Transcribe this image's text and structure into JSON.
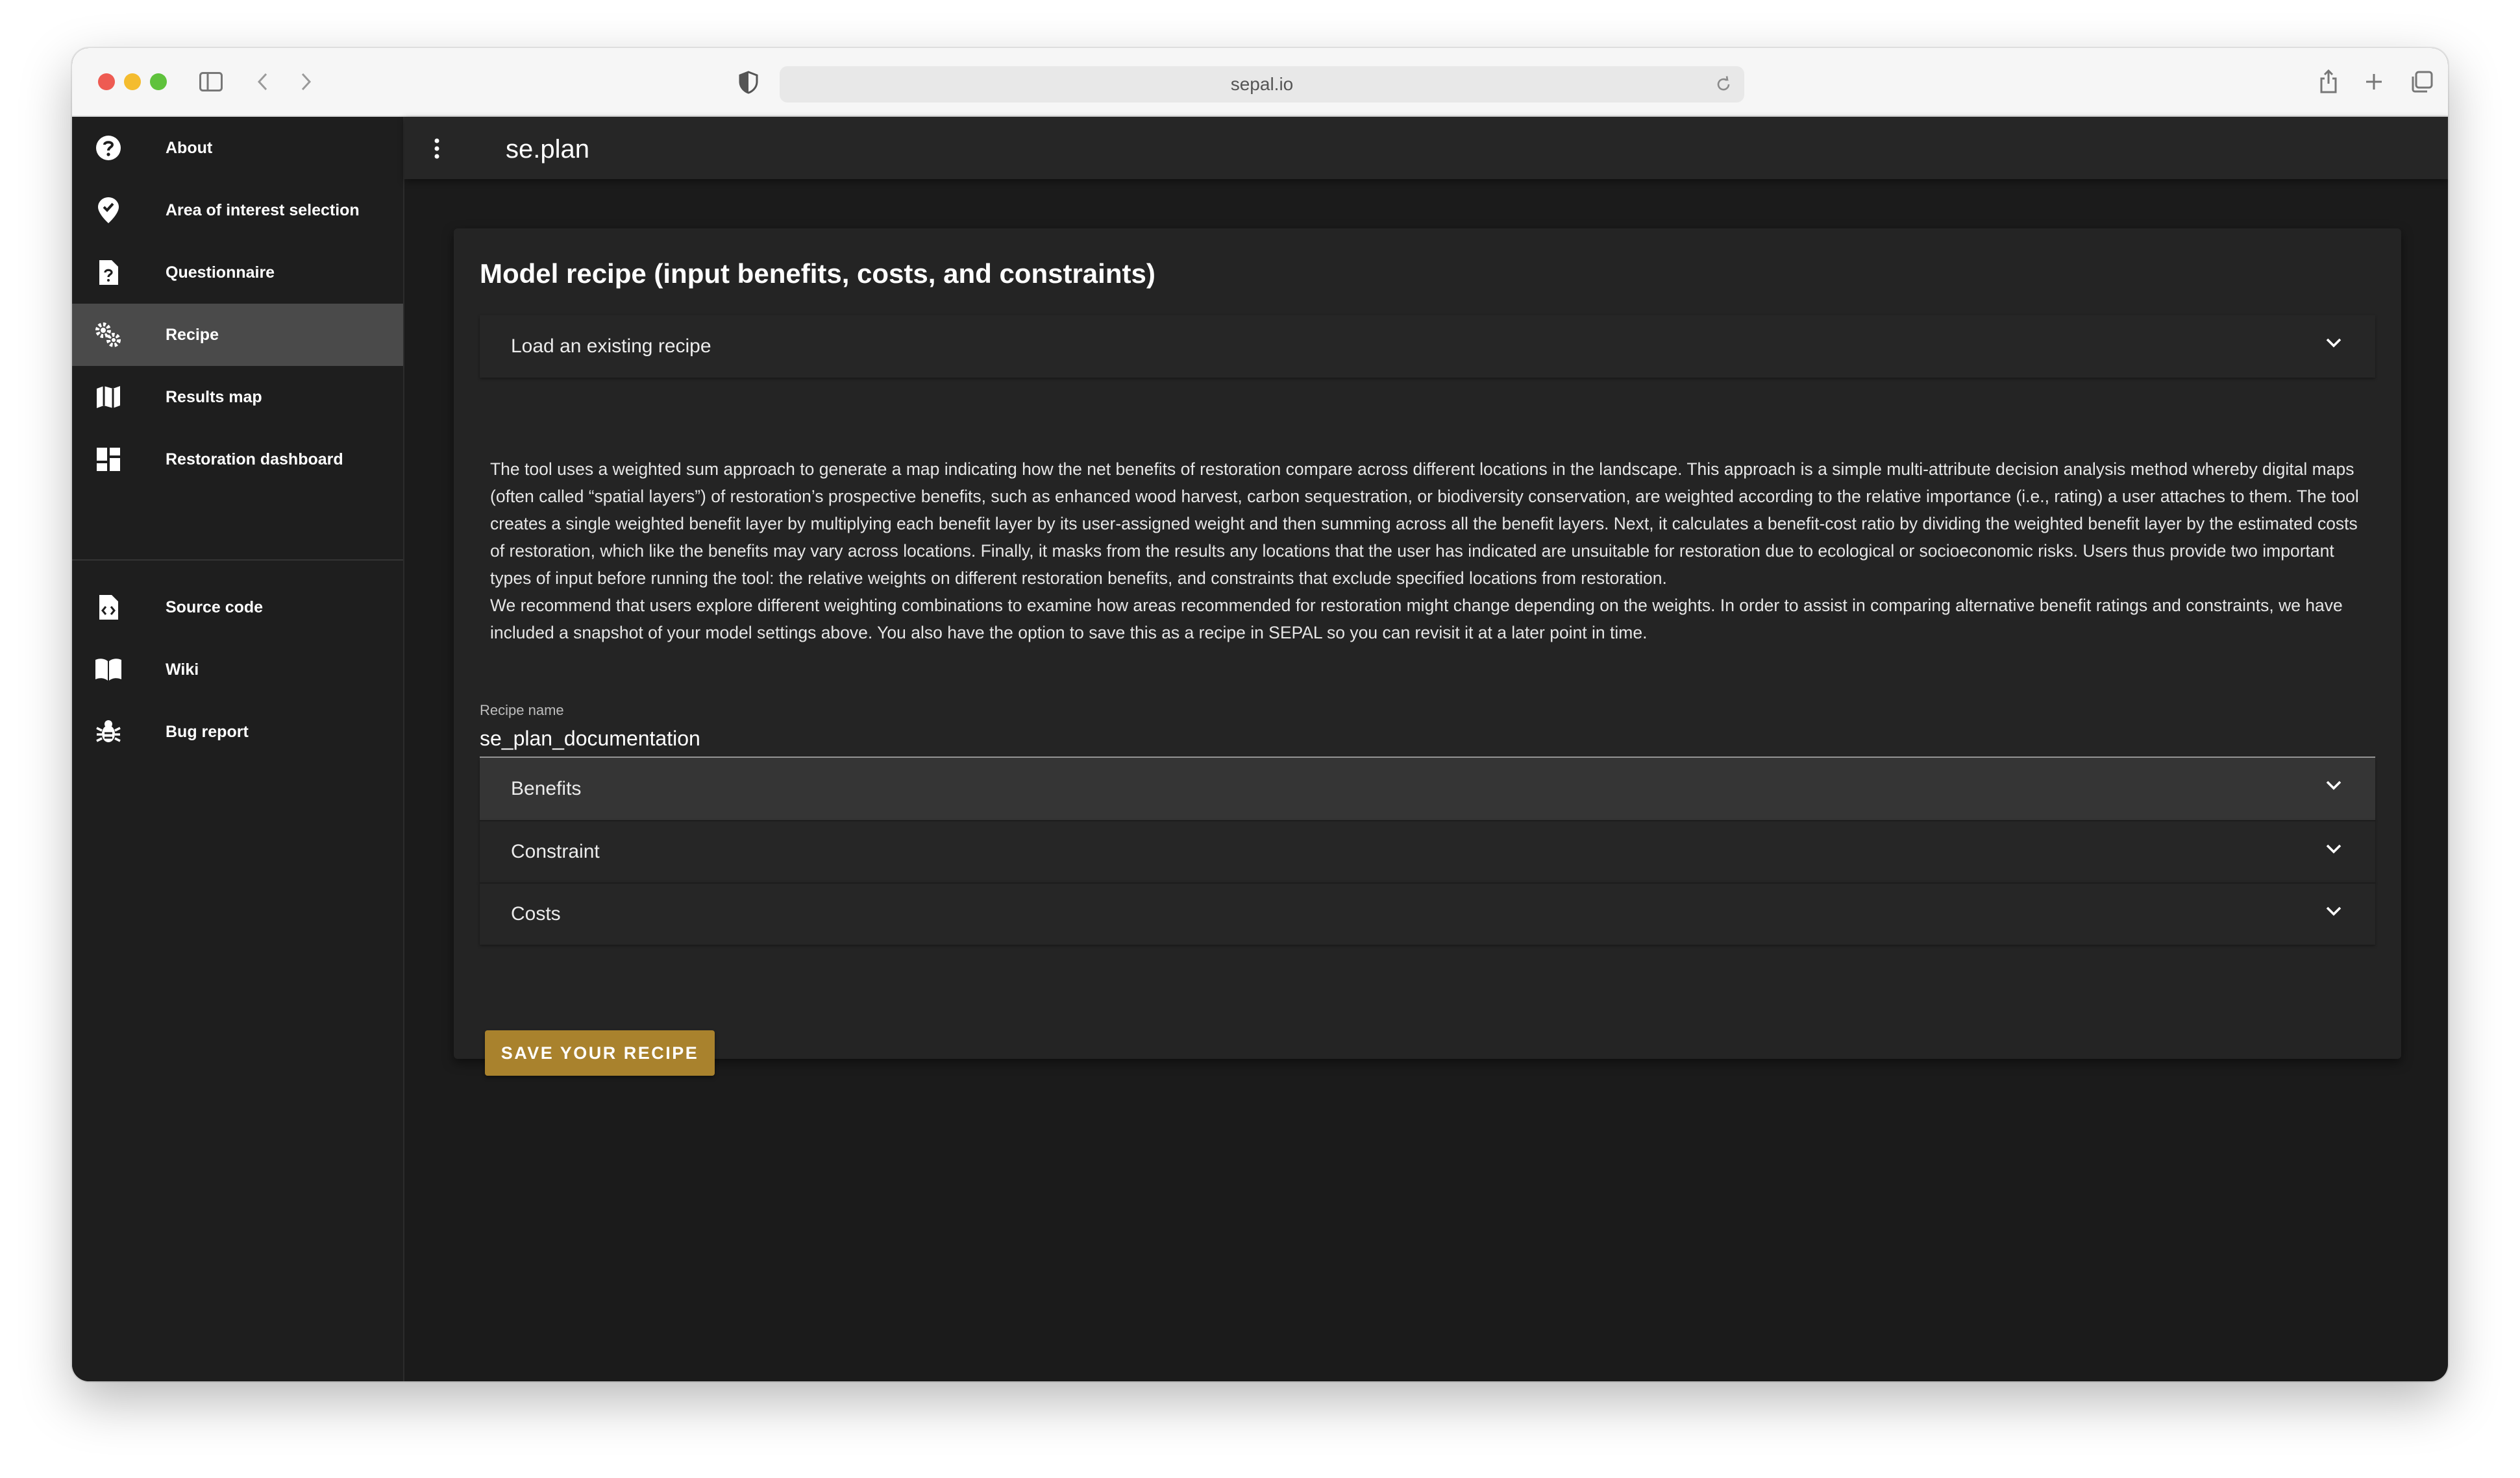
{
  "browser": {
    "url": "sepal.io"
  },
  "sidebar": {
    "items": [
      {
        "label": "About",
        "icon": "help-circle-icon"
      },
      {
        "label": "Area of interest selection",
        "icon": "map-marker-check-icon"
      },
      {
        "label": "Questionnaire",
        "icon": "file-question-icon"
      },
      {
        "label": "Recipe",
        "icon": "cogs-icon",
        "active": true
      },
      {
        "label": "Results map",
        "icon": "map-icon"
      },
      {
        "label": "Restoration dashboard",
        "icon": "dashboard-icon"
      },
      {
        "label": "Source code",
        "icon": "file-code-icon"
      },
      {
        "label": "Wiki",
        "icon": "book-open-icon"
      },
      {
        "label": "Bug report",
        "icon": "bug-icon"
      }
    ]
  },
  "appbar": {
    "title": "se.plan"
  },
  "recipe": {
    "title": "Model recipe (input benefits, costs, and constraints)",
    "load_panel": "Load an existing recipe",
    "description_1": "The tool uses a weighted sum approach to generate a map indicating how the net benefits of restoration compare across different locations in the landscape. This approach is a simple multi-attribute decision analysis method whereby digital maps (often called “spatial layers”) of restoration’s prospective benefits, such as enhanced wood harvest, carbon sequestration, or biodiversity conservation, are weighted according to the relative importance (i.e., rating) a user attaches to them. The tool creates a single weighted benefit layer by multiplying each benefit layer by its user-assigned weight and then summing across all the benefit layers. Next, it calculates a benefit-cost ratio by dividing the weighted benefit layer by the estimated costs of restoration, which like the benefits may vary across locations. Finally, it masks from the results any locations that the user has indicated are unsuitable for restoration due to ecological or socioeconomic risks. Users thus provide two important types of input before running the tool: the relative weights on different restoration benefits, and constraints that exclude specified locations from restoration.",
    "description_2": "We recommend that users explore different weighting combinations to examine how areas recommended for restoration might change depending on the weights. In order to assist in comparing alternative benefit ratings and constraints, we have included a snapshot of your model settings above. You also have the option to save this as a recipe in SEPAL so you can revisit it at a later point in time.",
    "name_label": "Recipe name",
    "name_value": "se_plan_documentation",
    "panels": {
      "benefits": "Benefits",
      "constraint": "Constraint",
      "costs": "Costs"
    },
    "save_label": "SAVE YOUR RECIPE"
  },
  "colors": {
    "accent": "#a9822d",
    "background": "#1b1b1b",
    "sidebar_active": "#4a4a4a"
  }
}
